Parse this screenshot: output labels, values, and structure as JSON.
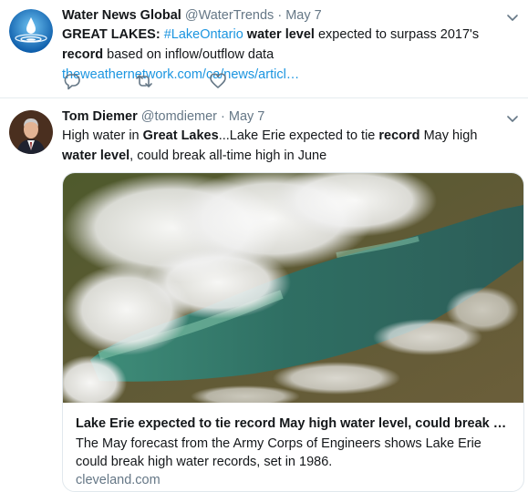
{
  "tweets": [
    {
      "name": "Water News Global",
      "handle": "@WaterTrends",
      "separator": "·",
      "date": "May 7",
      "avatar_icon": "water-drop-icon",
      "text_segments": [
        {
          "text": "GREAT LAKES: ",
          "style": "bold"
        },
        {
          "text": "#LakeOntario",
          "style": "link"
        },
        {
          "text": " ",
          "style": "plain"
        },
        {
          "text": "water level",
          "style": "bold"
        },
        {
          "text": " expected to surpass 2017's ",
          "style": "plain"
        },
        {
          "text": "record",
          "style": "bold"
        },
        {
          "text": " based on inflow/outflow data ",
          "style": "plain"
        },
        {
          "text": "theweathernetwork.com/ca/news/articl…",
          "style": "link"
        }
      ],
      "actions": [
        "reply-icon",
        "retweet-icon",
        "like-icon"
      ]
    },
    {
      "name": "Tom Diemer",
      "handle": "@tomdiemer",
      "separator": "·",
      "date": "May 7",
      "avatar_icon": "profile-photo",
      "text_segments": [
        {
          "text": "High water in ",
          "style": "plain"
        },
        {
          "text": "Great Lakes",
          "style": "bold"
        },
        {
          "text": "...Lake Erie expected to tie ",
          "style": "plain"
        },
        {
          "text": "record",
          "style": "bold"
        },
        {
          "text": " May high ",
          "style": "plain"
        },
        {
          "text": "water level",
          "style": "bold"
        },
        {
          "text": ", could break all-time high in June",
          "style": "plain"
        }
      ],
      "card": {
        "image_icon": "satellite-image-lake-erie",
        "title": "Lake Erie expected to tie record May high water level, could break all…",
        "description": "The May forecast from the Army Corps of Engineers shows Lake Erie could break high water records, set in 1986.",
        "domain": "cleveland.com"
      }
    }
  ],
  "colors": {
    "link": "#1b95e0",
    "secondary_text": "#657786",
    "primary_text": "#14171a",
    "divider": "#e6ecf0",
    "card_border": "#e1e8ed"
  }
}
